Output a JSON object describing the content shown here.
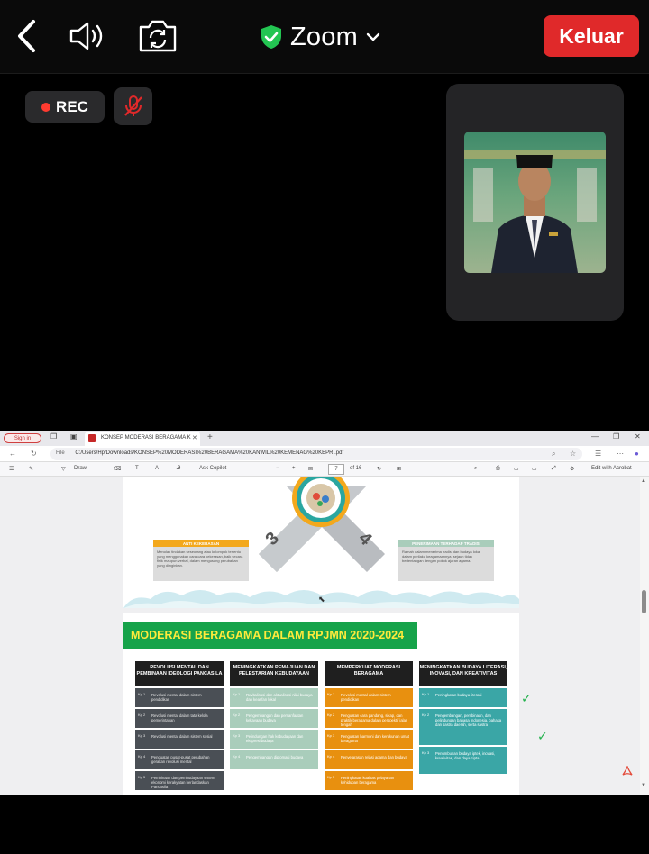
{
  "topbar": {
    "back_label": "<",
    "meeting_title": "Zoom",
    "leave_label": "Keluar"
  },
  "status": {
    "rec_label": "REC"
  },
  "browser": {
    "signin_label": "Sign in",
    "tab_title": "KONSEP MODERASI BERAGAMA K",
    "url_prefix": "File",
    "url": "C:/Users/Hp/Downloads/KONSEP%20MODERASI%20BERAGAMA%20KANWIL%20KEMENAG%20KEPRI.pdf"
  },
  "pdf_toolbar": {
    "draw_label": "Draw",
    "ask_copilot_label": "Ask Copilot",
    "page_current": "7",
    "page_total": "of 16",
    "edit_acrobat_label": "Edit with Acrobat"
  },
  "slide_top": {
    "left_box_title": "ANTI KEKERASAN",
    "left_box_text": "Menolak tindakan seseorang atau kelompok tertentu yang menggunakan cara-cara kekerasan, baik secara fisik maupun verbal, dalam mengusung perubahan yang diinginkan.",
    "right_box_title": "PENERIMAAN TERHADAP TRADISI",
    "right_box_text": "Ramah dalam menerima tradisi dan budaya lokal dalam perilaku keagamaannya, sejauh tidak bertentangan dengan pokok ajaran agama.",
    "num_3": "3",
    "num_4": "4"
  },
  "slide_bottom": {
    "title": "MODERASI BERAGAMA DALAM RPJMN 2020-2024",
    "columns": [
      {
        "header": "REVOLUSI MENTAL DAN PEMBINAAN IDEOLOGI PANCASILA",
        "rows": [
          {
            "kp": "Kp 1",
            "text": "Revolusi mental dalam sistem pendidikan"
          },
          {
            "kp": "Kp 2",
            "text": "Revolusi mental dalam tata kelola pemerintahan"
          },
          {
            "kp": "Kp 3",
            "text": "Revolusi mental dalam sistem sosial"
          },
          {
            "kp": "Kp 4",
            "text": "Penguatan pusat-pusat perubahan gerakan revolusi mental"
          },
          {
            "kp": "Kp 5",
            "text": "Pembinaan dan pembudayaan sistem ekonomi kerakyatan berlandaskan Pancasila"
          }
        ]
      },
      {
        "header": "MENINGKATKAN PEMAJUAN DAN PELESTARIAN KEBUDAYAAN",
        "rows": [
          {
            "kp": "Kp 1",
            "text": "Revitalisasi dan aktualisasi nilai budaya dan kearifan lokal"
          },
          {
            "kp": "Kp 2",
            "text": "Pengembangan dan pemanfaatan kekayaan budaya"
          },
          {
            "kp": "Kp 3",
            "text": "Pelindungan hak kebudayaan dan ekspresi budaya"
          },
          {
            "kp": "Kp 4",
            "text": "Pengembangan diplomasi budaya"
          }
        ]
      },
      {
        "header": "MEMPERKUAT MODERASI BERAGAMA",
        "rows": [
          {
            "kp": "Kp 1",
            "text": "Revolusi mental dalam sistem pendidikan"
          },
          {
            "kp": "Kp 2",
            "text": "Penguatan cara pandang, sikap, dan praktik beragama dalam perspektif jalan tengah"
          },
          {
            "kp": "Kp 3",
            "text": "Penguatan harmoni dan kerukunan umat beragama"
          },
          {
            "kp": "Kp 4",
            "text": "Penyelarasan relasi agama dan budaya"
          },
          {
            "kp": "Kp 5",
            "text": "Peningkatan kualitas pelayanan kehidupan beragama"
          }
        ]
      },
      {
        "header": "MENINGKATKAN BUDAYA LITERASI, INOVASI, DAN KREATIVITAS",
        "rows": [
          {
            "kp": "Kp 1",
            "text": "Peningkatan budaya literasi"
          },
          {
            "kp": "Kp 2",
            "text": "Pengembangan, pembinaan, dan pelindungan bahasa Indonesia, bahasa dan sastra daerah, serta sastra"
          },
          {
            "kp": "Kp 3",
            "text": "Penumbuhan budaya iptek, inovasi, kreativitas, dan daya cipta"
          }
        ]
      }
    ]
  },
  "colors": {
    "leave_red": "#e0292a",
    "title_green": "#16a34a",
    "title_yellow": "#ffea3b",
    "col1": "#4a4f55",
    "col2": "#a9cdbb",
    "col3": "#e8900f",
    "col4": "#3aa6a6"
  }
}
